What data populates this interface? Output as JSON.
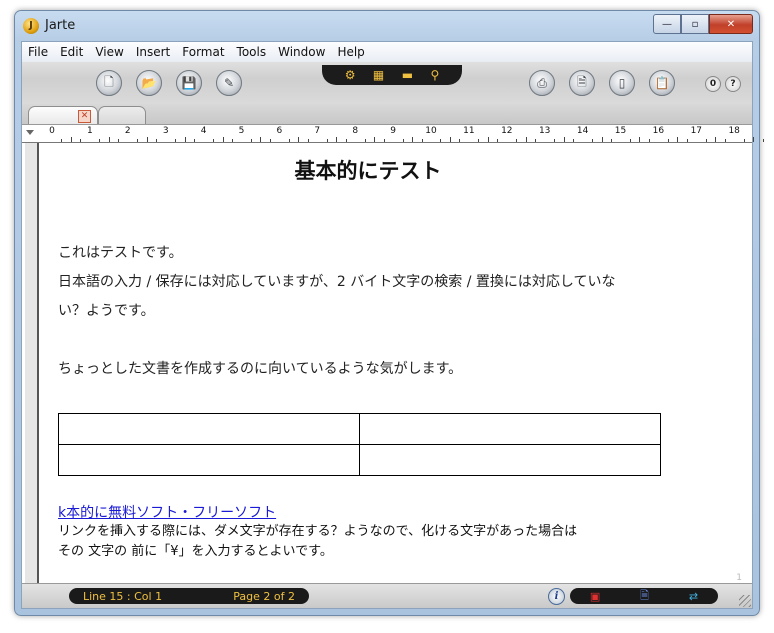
{
  "window": {
    "title": "Jarte",
    "app_icon": "J"
  },
  "caption_buttons": {
    "minimize": "—",
    "maximize": "▫",
    "close": "✕"
  },
  "menu": [
    "File",
    "Edit",
    "View",
    "Insert",
    "Format",
    "Tools",
    "Window",
    "Help"
  ],
  "toolbar": {
    "left_icons": [
      "new-document-icon",
      "open-icon",
      "save-icon",
      "edit-icon"
    ],
    "center_icons": [
      "insert-object-icon",
      "chart-icon",
      "folder-icon",
      "search-icon"
    ],
    "right_icons": [
      "print-icon",
      "document-icon",
      "book-icon",
      "clipboard-icon"
    ],
    "help_buttons": [
      "0",
      "?"
    ]
  },
  "ruler": {
    "labels": [
      "0",
      "1",
      "2",
      "3",
      "4",
      "5",
      "6",
      "7",
      "8",
      "9",
      "10",
      "11",
      "12",
      "13",
      "14",
      "15",
      "16",
      "17",
      "18"
    ]
  },
  "document": {
    "title": "基本的にテスト",
    "paragraph1": "これはテストです。",
    "paragraph2_line1": "日本語の入力 / 保存には対応していますが、2 バイト文字の検索 / 置換には対応していな",
    "paragraph2_line2": "い？ようです。",
    "paragraph3": "ちょっとした文書を作成するのに向いているような気がします。",
    "table_rows": 2,
    "table_cols": 2,
    "link_text": "k本的に無料ソフト・フリーソフト",
    "note_line1": "リンクを挿入する際には、ダメ文字が存在する？ようなので、化ける文字があった場合は",
    "note_line2": "その 文字の 前に「¥」を入力するとよいです。",
    "page_marker": "1"
  },
  "status": {
    "position": "Line 15 : Col 1",
    "page": "Page 2 of 2",
    "info_icon": "i",
    "right_icons": [
      "save-status-icon",
      "document-status-icon",
      "wrap-icon"
    ]
  },
  "colors": {
    "status_text": "#f0c040",
    "link": "#1a1ad6",
    "accent": "#e0a010"
  }
}
